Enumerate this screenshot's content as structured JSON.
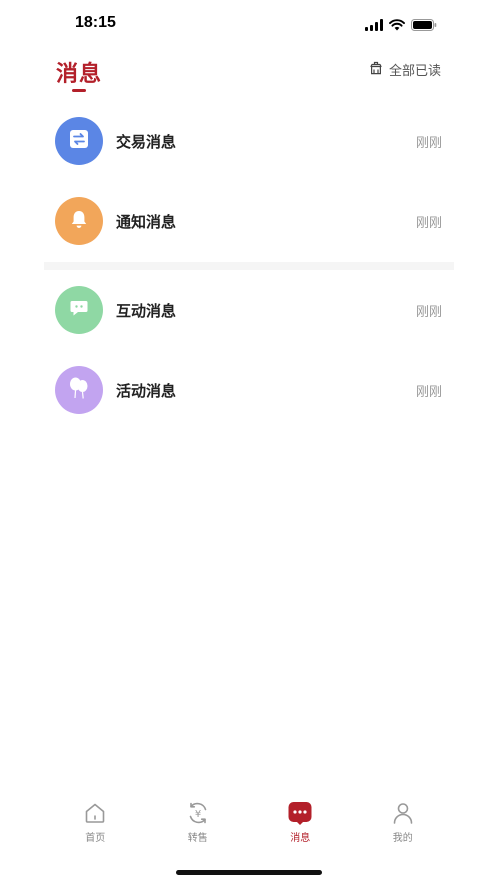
{
  "status_bar": {
    "time": "18:15"
  },
  "header": {
    "title": "消息",
    "mark_all_read": "全部已读"
  },
  "messages": [
    {
      "title": "交易消息",
      "time": "刚刚",
      "icon": "exchange-icon",
      "color": "#5b86e5"
    },
    {
      "title": "通知消息",
      "time": "刚刚",
      "icon": "bell-icon",
      "color": "#f2a65a"
    },
    {
      "title": "互动消息",
      "time": "刚刚",
      "icon": "chat-icon",
      "color": "#8fd8a4"
    },
    {
      "title": "活动消息",
      "time": "刚刚",
      "icon": "balloon-icon",
      "color": "#c2a4f0"
    }
  ],
  "tabs": [
    {
      "label": "首页",
      "icon": "home-icon"
    },
    {
      "label": "转售",
      "icon": "resale-icon"
    },
    {
      "label": "消息",
      "icon": "message-icon",
      "active": true
    },
    {
      "label": "我的",
      "icon": "profile-icon"
    }
  ],
  "colors": {
    "accent": "#b3202a"
  }
}
